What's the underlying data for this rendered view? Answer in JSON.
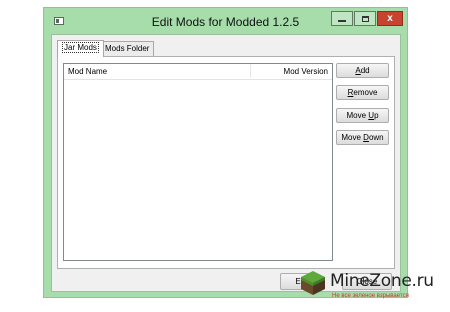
{
  "window": {
    "title": "Edit Mods for Modded 1.2.5",
    "close_label": "x"
  },
  "tabs": [
    {
      "label": "Jar Mods",
      "selected": true
    },
    {
      "label": "Mods Folder",
      "selected": false
    }
  ],
  "mod_list": {
    "columns": [
      "Mod Name",
      "Mod Version"
    ],
    "rows": []
  },
  "buttons": {
    "add": {
      "pre": "",
      "key": "A",
      "post": "dd"
    },
    "remove": {
      "pre": "",
      "key": "R",
      "post": "emove"
    },
    "move_up": {
      "pre": "Move ",
      "key": "U",
      "post": "p"
    },
    "move_down": {
      "pre": "Move ",
      "key": "D",
      "post": "own"
    }
  },
  "footer": {
    "left_button": "E",
    "right_button": "Close"
  },
  "watermark": {
    "brand": "MineZone.ru",
    "tagline": "Не все зеленое взрывается"
  },
  "colors": {
    "frame": "#a7ddab",
    "close": "#c7432f"
  }
}
